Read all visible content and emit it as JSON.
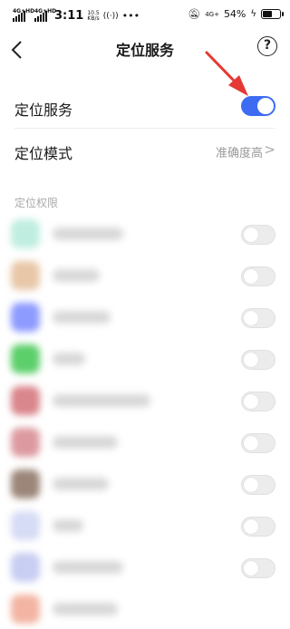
{
  "status_bar": {
    "network_1": "4G+HD",
    "network_2": "4G+HD",
    "time": "3:11",
    "speed_value": "10.5",
    "speed_unit": "KB/s",
    "small_network": "4G+",
    "battery": "54%",
    "battery_level": 0.54
  },
  "header": {
    "title": "定位服务",
    "back_icon": "chevron-left-icon",
    "help_icon": "question-circle-icon"
  },
  "settings": {
    "location_service": {
      "label": "定位服务",
      "enabled": true
    },
    "location_mode": {
      "label": "定位模式",
      "value": "准确度高"
    }
  },
  "permissions_section": {
    "title": "定位权限"
  },
  "apps": [
    {
      "icon_color": "#bfeee0",
      "enabled": false
    },
    {
      "icon_color": "#e8c7a8",
      "enabled": false
    },
    {
      "icon_color": "#8d9bff",
      "enabled": false
    },
    {
      "icon_color": "#5ccf6b",
      "enabled": false
    },
    {
      "icon_color": "#d9868c",
      "enabled": false
    },
    {
      "icon_color": "#dc9aa0",
      "enabled": false
    },
    {
      "icon_color": "#9b8679",
      "enabled": false
    },
    {
      "icon_color": "#d6dcf5",
      "enabled": false
    },
    {
      "icon_color": "#c8cdf2",
      "enabled": false
    },
    {
      "icon_color": "#f3b4a3",
      "enabled": false
    }
  ],
  "colors": {
    "accent": "#3d6cf2",
    "annotation_arrow": "#e53935"
  }
}
